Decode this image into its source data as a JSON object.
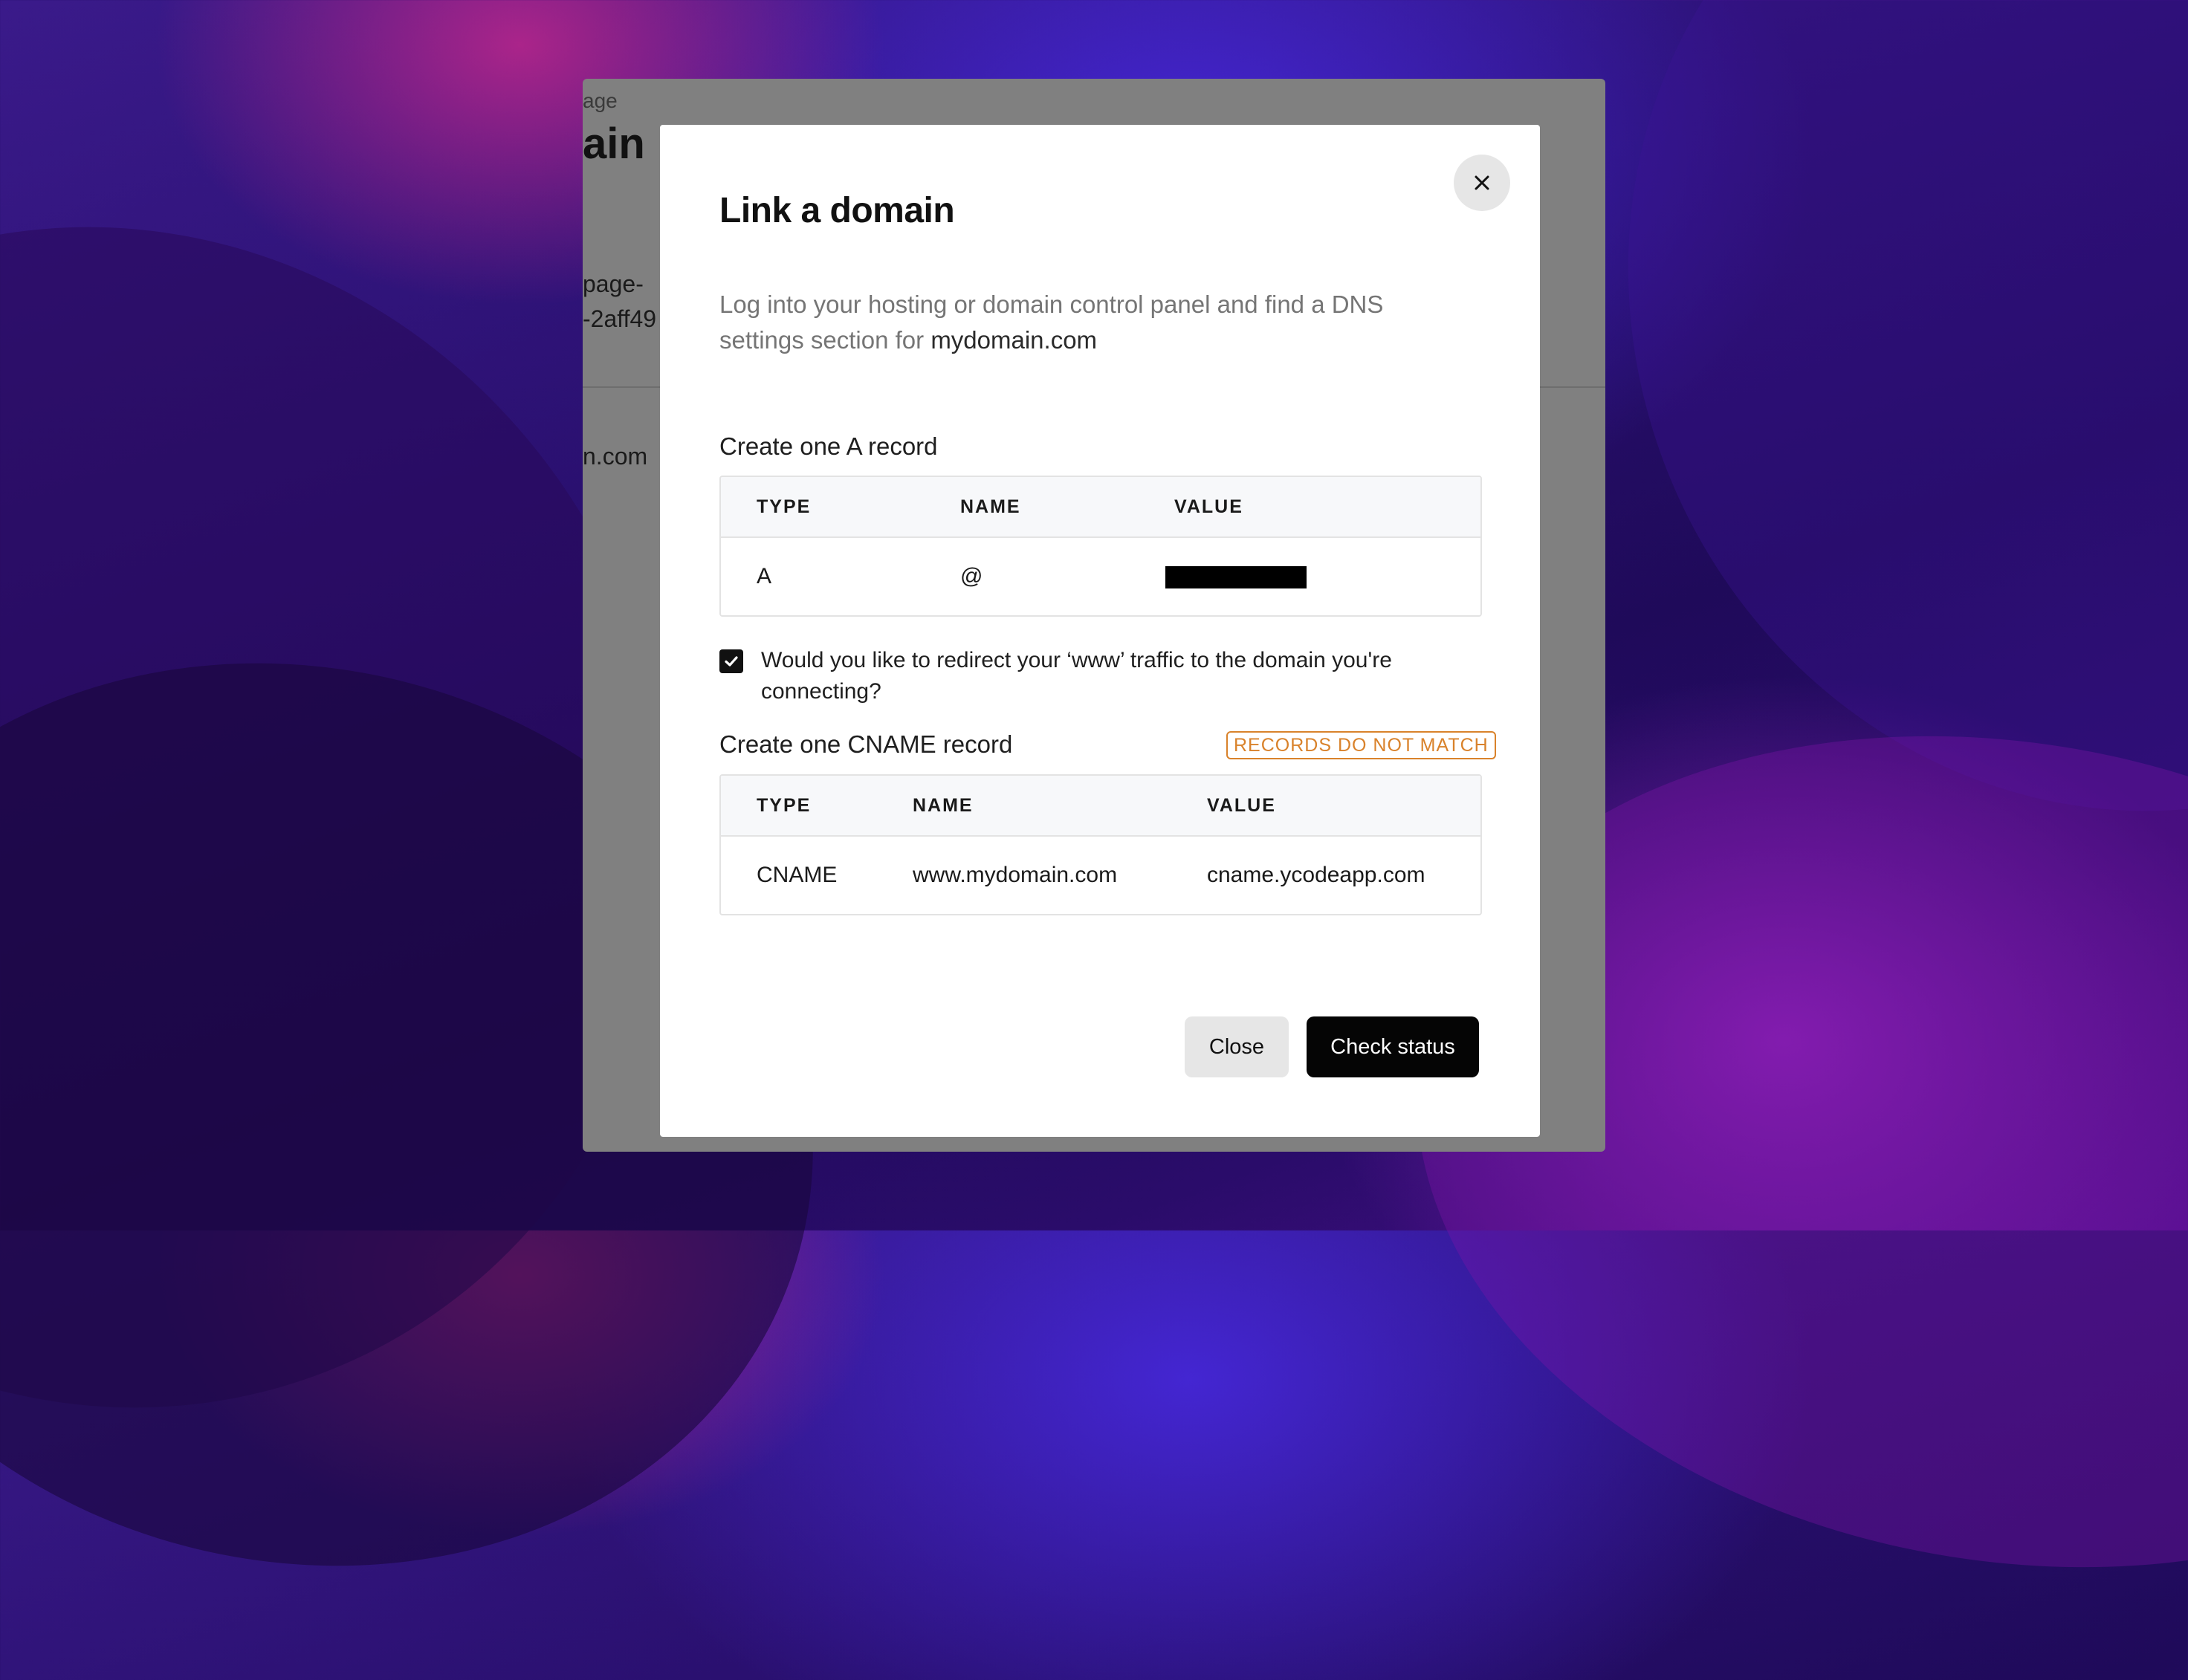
{
  "background_window": {
    "crumb": "age",
    "title": "ain",
    "line1": "page-",
    "line2": "-2aff49",
    "domain": "n.com"
  },
  "modal": {
    "title": "Link a domain",
    "description_prefix": "Log into your hosting or domain control panel and find a DNS settings section for",
    "description_domain": "mydomain.com",
    "close_icon": "close-icon"
  },
  "a_record": {
    "title": "Create one A record",
    "headers": [
      "TYPE",
      "NAME",
      "VALUE"
    ],
    "row": {
      "type": "A",
      "name": "@",
      "value": ""
    }
  },
  "redirect": {
    "checked": true,
    "label": "Would you like to redirect your ‘www’ traffic to the domain you're connecting?"
  },
  "cname_record": {
    "title": "Create one CNAME record",
    "status_badge": "RECORDS DO NOT MATCH",
    "headers": [
      "TYPE",
      "NAME",
      "VALUE"
    ],
    "row": {
      "type": "CNAME",
      "name": "www.mydomain.com",
      "value": "cname.ycodeapp.com"
    }
  },
  "buttons": {
    "close": "Close",
    "check_status": "Check status"
  },
  "colors": {
    "badge": "#d9822b",
    "primary_button": "#050505",
    "secondary_button": "#e6e6e6"
  }
}
